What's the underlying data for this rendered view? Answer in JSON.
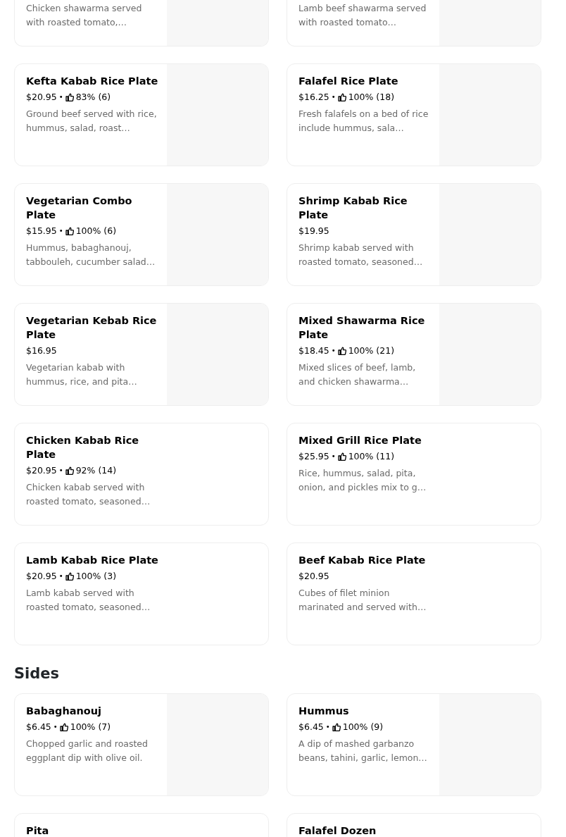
{
  "sections": [
    {
      "items": [
        {
          "kind": "cut_top",
          "description": "Chicken shawarma served with roasted tomato,…",
          "has_image": true
        },
        {
          "kind": "cut_top",
          "description": "Lamb beef shawarma served with roasted tomato…",
          "has_image": true
        },
        {
          "kind": "full",
          "name": "Kefta Kabab Rice Plate",
          "price": "$20.95",
          "separator": "•",
          "rating": "83% (6)",
          "description": "Ground beef served with rice, hummus, salad, roast…",
          "has_image": true
        },
        {
          "kind": "full",
          "name": "Falafel Rice Plate",
          "price": "$16.25",
          "separator": "•",
          "rating": "100% (18)",
          "description": "Fresh falafels on a bed of rice include hummus, sala…",
          "has_image": true
        },
        {
          "kind": "full",
          "name": "Vegetarian Combo Plate",
          "price": "$15.95",
          "separator": "•",
          "rating": "100% (6)",
          "description": "Hummus, babaghanouj, tabbouleh, cucumber salad…",
          "has_image": true
        },
        {
          "kind": "full",
          "name": "Shrimp Kabab Rice Plate",
          "price": "$19.95",
          "description": "Shrimp kabab served with roasted tomato, seasoned…",
          "has_image": true
        },
        {
          "kind": "full",
          "name": "Vegetarian Kebab Rice Plate",
          "price": "$16.95",
          "description": "Vegetarian kabab with hummus, rice, and pita…",
          "has_image": true
        },
        {
          "kind": "full",
          "name": "Mixed Shawarma Rice Plate",
          "price": "$18.45",
          "separator": "•",
          "rating": "100% (21)",
          "description": "Mixed slices of beef, lamb, and chicken shawarma…",
          "has_image": true
        },
        {
          "kind": "full",
          "name": "Chicken Kabab Rice Plate",
          "price": "$20.95",
          "separator": "•",
          "rating": "92% (14)",
          "description": "Chicken kabab served with roasted tomato, seasoned…",
          "has_image": false
        },
        {
          "kind": "full",
          "name": "Mixed Grill Rice Plate",
          "price": "$25.95",
          "separator": "•",
          "rating": "100% (11)",
          "description": "Rice, hummus, salad, pita, onion, and pickles mix to g…",
          "has_image": false
        },
        {
          "kind": "full",
          "name": "Lamb Kabab Rice Plate",
          "price": "$20.95",
          "separator": "•",
          "rating": "100% (3)",
          "description": "Lamb kabab served with roasted tomato, seasoned…",
          "has_image": false
        },
        {
          "kind": "full",
          "name": "Beef Kabab Rice Plate",
          "price": "$20.95",
          "description": "Cubes of filet minion marinated and served with…",
          "has_image": false
        }
      ]
    },
    {
      "title": "Sides",
      "items": [
        {
          "kind": "full",
          "name": "Babaghanouj",
          "price": "$6.45",
          "separator": "•",
          "rating": "100% (7)",
          "description": "Chopped garlic and roasted eggplant dip with olive oil.",
          "has_image": true
        },
        {
          "kind": "full",
          "name": "Hummus",
          "price": "$6.45",
          "separator": "•",
          "rating": "100% (9)",
          "description": "A dip of mashed garbanzo beans, tahini, garlic, lemon…",
          "has_image": true
        },
        {
          "kind": "full",
          "name": "Pita",
          "has_image": false
        },
        {
          "kind": "full",
          "name": "Falafel Dozen",
          "has_image": false
        }
      ]
    }
  ]
}
